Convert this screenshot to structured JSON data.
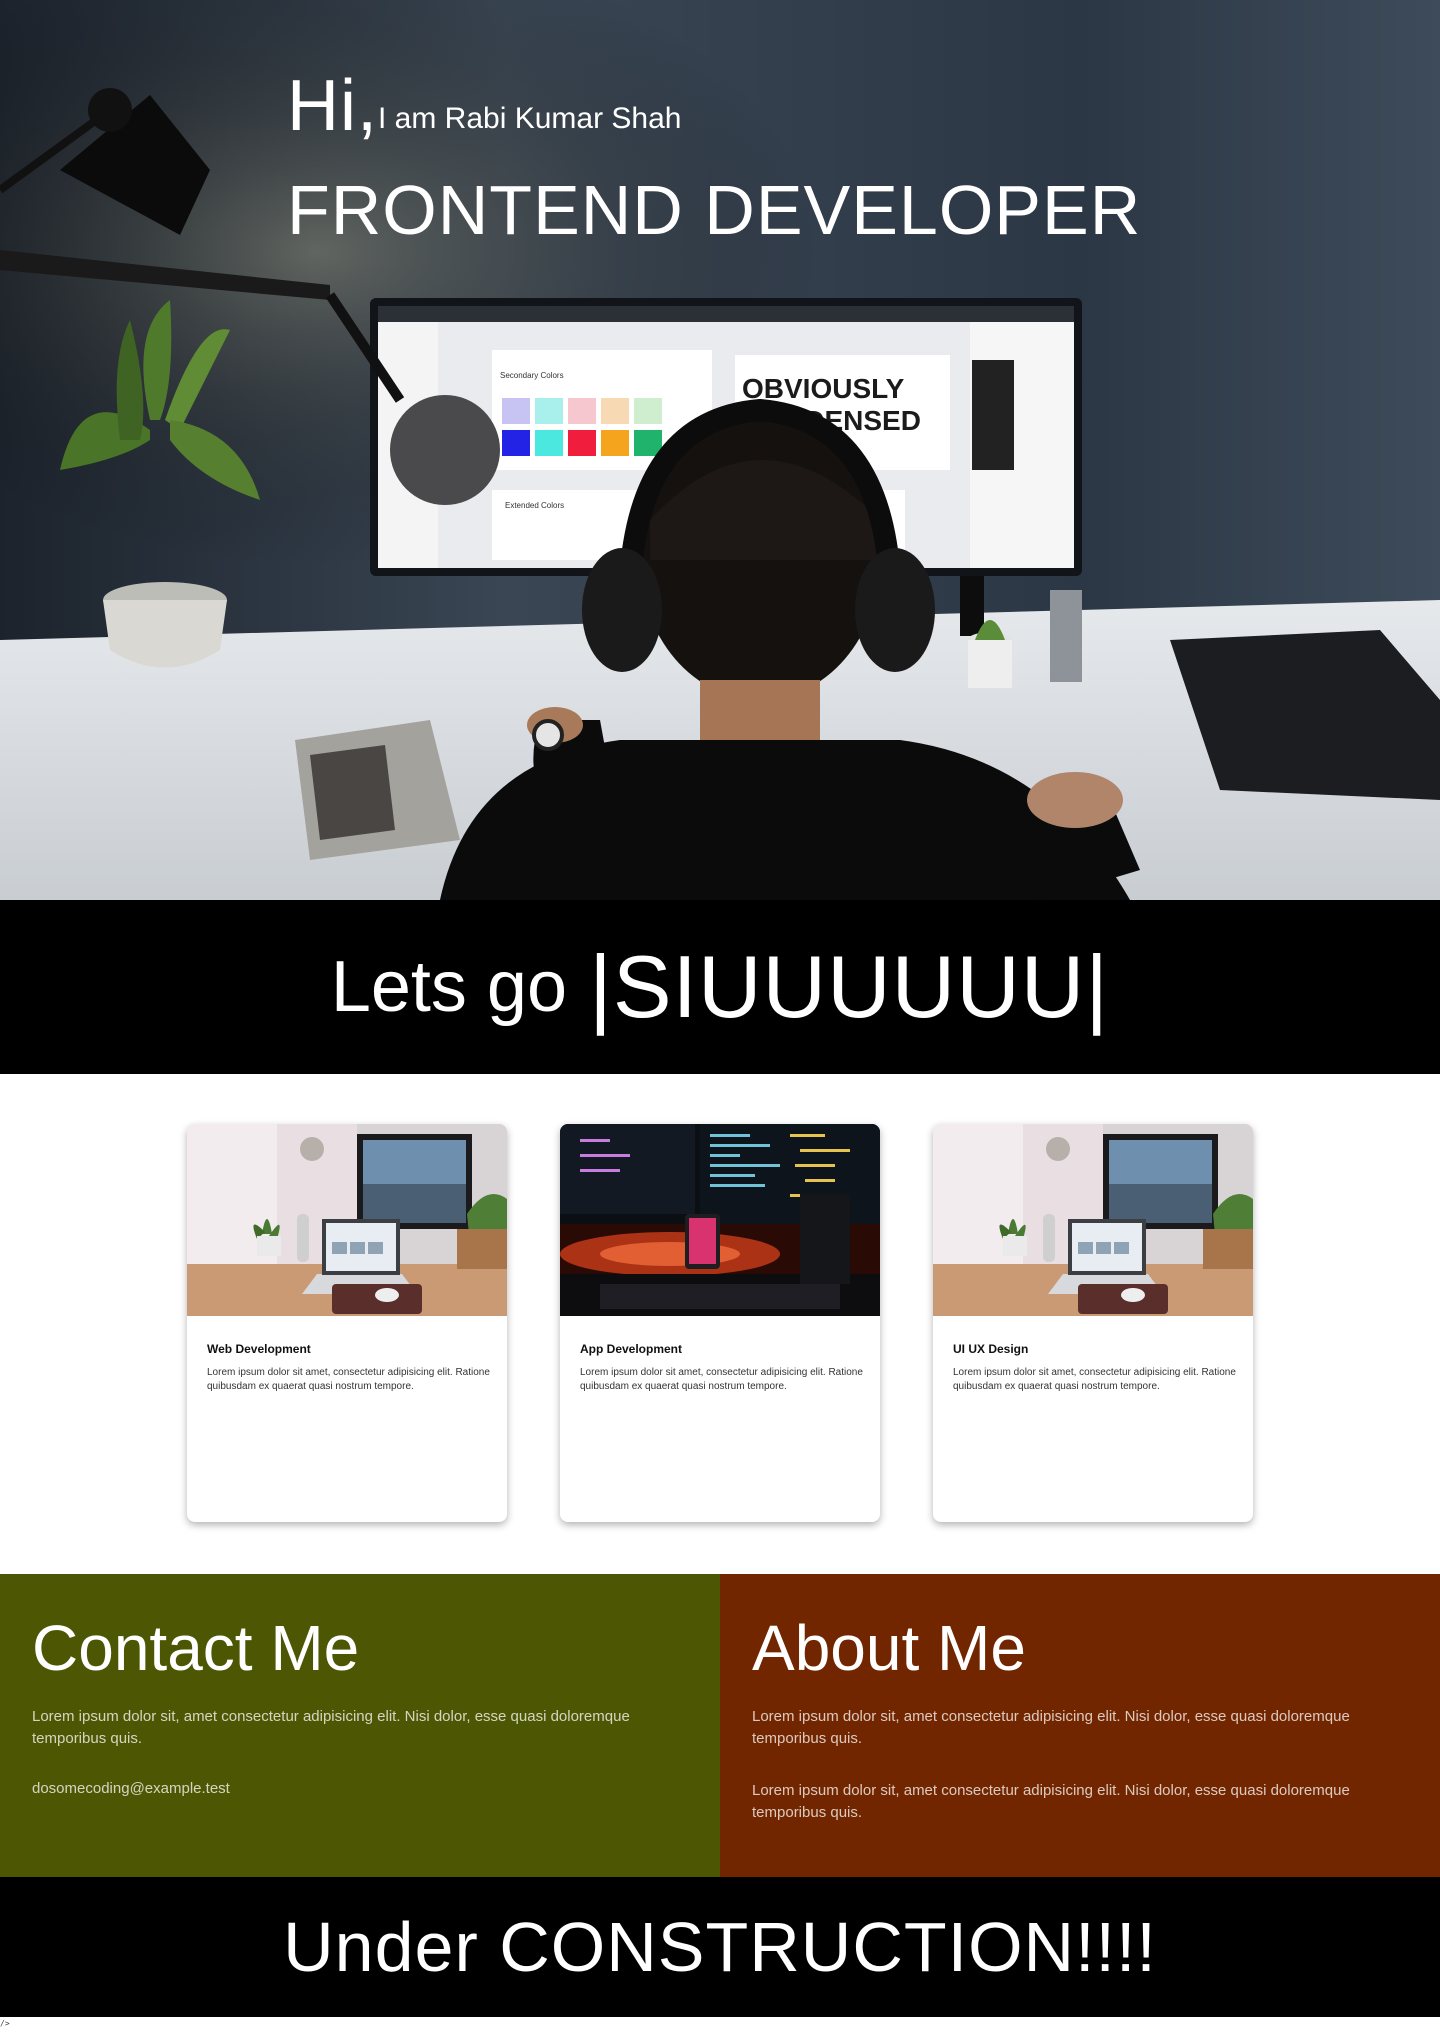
{
  "hero": {
    "hi": "Hi,",
    "intro": "I am Rabi Kumar Shah",
    "role": "FRONTEND DEVELOPER",
    "monitor_text_1": "OBVIOUSLY",
    "monitor_text_2": "CONDENSED",
    "monitor_panel_1": "Secondary Colors",
    "monitor_panel_2": "Extended Colors"
  },
  "banner": {
    "lead": "Lets go",
    "highlight": "|SIUUUUUU|"
  },
  "cards": [
    {
      "title": "Web Development",
      "description": "Lorem ipsum dolor sit amet, consectetur adipisicing elit. Ratione quibusdam ex quaerat quasi nostrum tempore."
    },
    {
      "title": "App Development",
      "description": "Lorem ipsum dolor sit amet, consectetur adipisicing elit. Ratione quibusdam ex quaerat quasi nostrum tempore."
    },
    {
      "title": "UI UX Design",
      "description": "Lorem ipsum dolor sit amet, consectetur adipisicing elit. Ratione quibusdam ex quaerat quasi nostrum tempore."
    }
  ],
  "contact": {
    "heading": "Contact Me",
    "text": "Lorem ipsum dolor sit, amet consectetur adipisicing elit. Nisi dolor, esse quasi doloremque temporibus quis.",
    "email": "dosomecoding@example.test"
  },
  "about": {
    "heading": "About Me",
    "text_1": "Lorem ipsum dolor sit, amet consectetur adipisicing elit. Nisi dolor, esse quasi doloremque temporibus quis.",
    "text_2": "Lorem ipsum dolor sit, amet consectetur adipisicing elit. Nisi dolor, esse quasi doloremque temporibus quis."
  },
  "footer": {
    "text": "Under CONSTRUCTION!!!!"
  },
  "stray_text": "/>",
  "colors": {
    "contact_bg": "#4d5703",
    "about_bg": "#712600",
    "banner_bg": "#000000"
  }
}
